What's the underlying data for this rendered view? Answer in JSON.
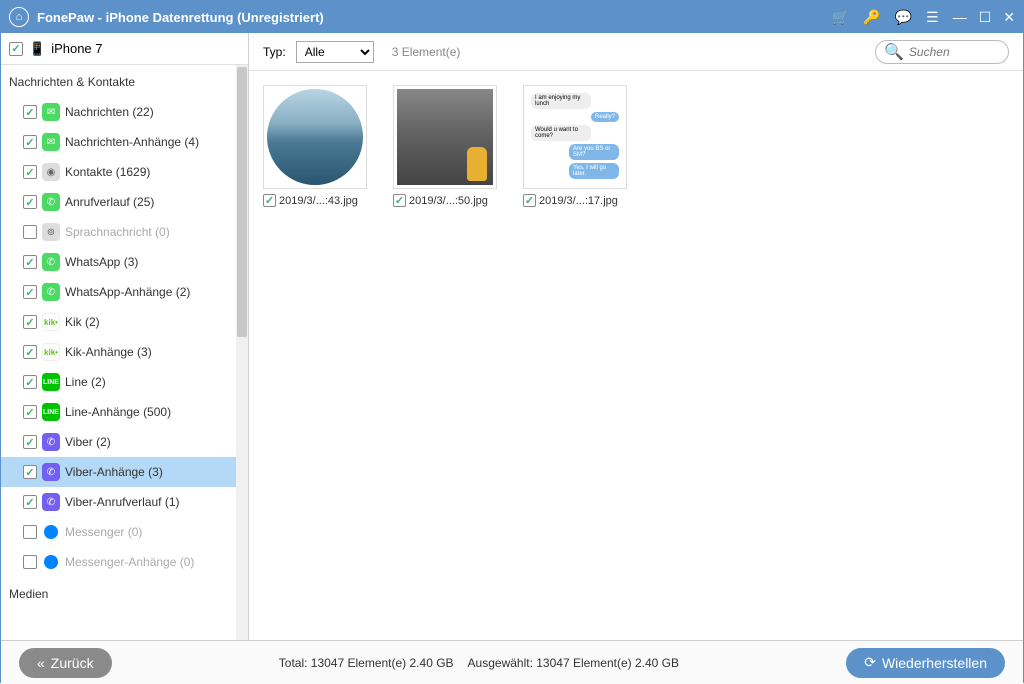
{
  "titlebar": {
    "title": "FonePaw - iPhone Datenrettung (Unregistriert)"
  },
  "device": {
    "name": "iPhone 7"
  },
  "sidebar": {
    "section1": "Nachrichten & Kontakte",
    "section2": "Medien",
    "items": [
      {
        "label": "Nachrichten (22)",
        "checked": true,
        "icon": "green",
        "glyph": "✉"
      },
      {
        "label": "Nachrichten-Anhänge (4)",
        "checked": true,
        "icon": "green",
        "glyph": "✉"
      },
      {
        "label": "Kontakte (1629)",
        "checked": true,
        "icon": "grey",
        "glyph": "◉"
      },
      {
        "label": "Anrufverlauf (25)",
        "checked": true,
        "icon": "phone",
        "glyph": "✆"
      },
      {
        "label": "Sprachnachricht (0)",
        "checked": false,
        "disabled": true,
        "icon": "grey",
        "glyph": "⊚"
      },
      {
        "label": "WhatsApp (3)",
        "checked": true,
        "icon": "green",
        "glyph": "✆"
      },
      {
        "label": "WhatsApp-Anhänge (2)",
        "checked": true,
        "icon": "green",
        "glyph": "✆"
      },
      {
        "label": "Kik (2)",
        "checked": true,
        "icon": "kik",
        "glyph": "kik•"
      },
      {
        "label": "Kik-Anhänge (3)",
        "checked": true,
        "icon": "kik",
        "glyph": "kik•"
      },
      {
        "label": "Line (2)",
        "checked": true,
        "icon": "line",
        "glyph": "LINE"
      },
      {
        "label": "Line-Anhänge (500)",
        "checked": true,
        "icon": "line",
        "glyph": "LINE"
      },
      {
        "label": "Viber (2)",
        "checked": true,
        "icon": "viber",
        "glyph": "✆"
      },
      {
        "label": "Viber-Anhänge (3)",
        "checked": true,
        "icon": "viber",
        "glyph": "✆",
        "selected": true
      },
      {
        "label": "Viber-Anrufverlauf (1)",
        "checked": true,
        "icon": "viber",
        "glyph": "✆"
      },
      {
        "label": "Messenger (0)",
        "checked": false,
        "disabled": true,
        "icon": "msg",
        "glyph": ""
      },
      {
        "label": "Messenger-Anhänge (0)",
        "checked": false,
        "disabled": true,
        "icon": "msg",
        "glyph": ""
      }
    ]
  },
  "toolbar": {
    "type_label": "Typ:",
    "type_value": "Alle",
    "count": "3 Element(e)",
    "search_placeholder": "Suchen"
  },
  "grid": {
    "files": [
      {
        "name": "2019/3/...:43.jpg"
      },
      {
        "name": "2019/3/...:50.jpg"
      },
      {
        "name": "2019/3/...:17.jpg"
      }
    ]
  },
  "footer": {
    "back": "Zurück",
    "total_label": "Total: 13047 Element(e) 2.40 GB",
    "selected_label": "Ausgewählt: 13047 Element(e) 2.40 GB",
    "recover": "Wiederherstellen"
  }
}
